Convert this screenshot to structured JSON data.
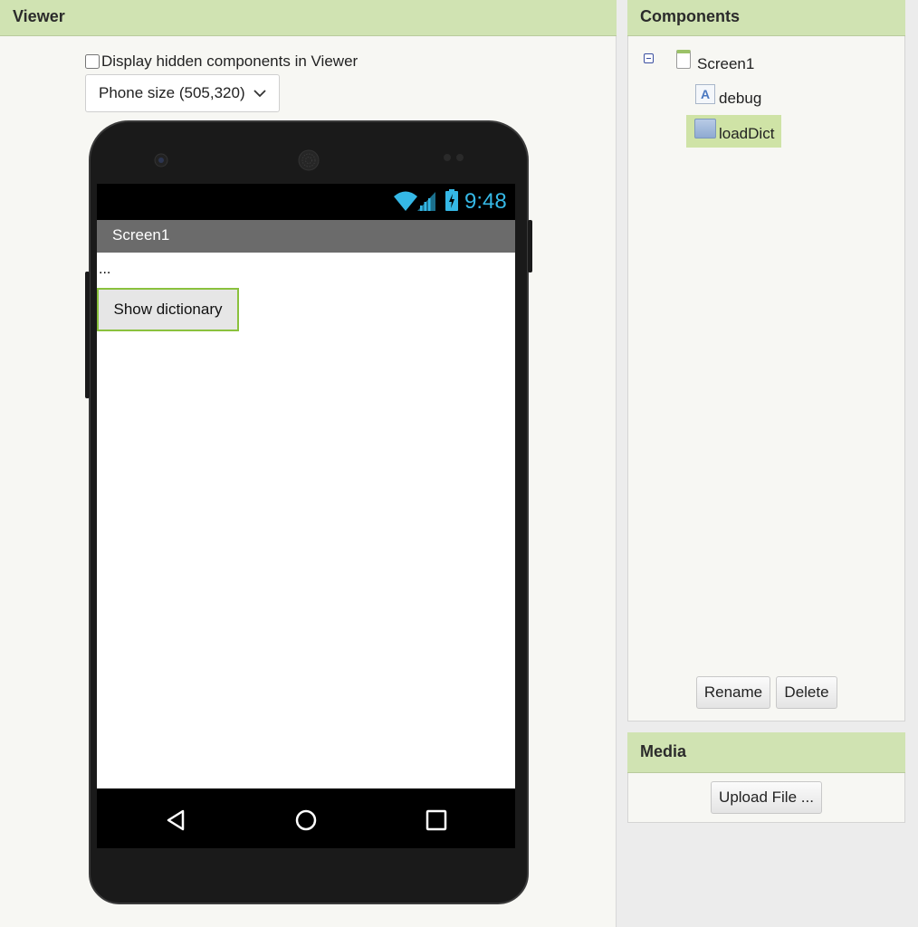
{
  "viewer": {
    "title": "Viewer",
    "hidden_components_label": "Display hidden components in Viewer",
    "hidden_components_checked": false,
    "size_select": "Phone size (505,320)"
  },
  "phone": {
    "status_time": "9:48",
    "screen_title": "Screen1",
    "debug_text": "...",
    "button_label": "Show dictionary"
  },
  "components": {
    "title": "Components",
    "tree": {
      "root": "Screen1",
      "children": [
        "debug",
        "loadDict"
      ],
      "selected": "loadDict"
    },
    "rename_label": "Rename",
    "delete_label": "Delete"
  },
  "media": {
    "title": "Media",
    "upload_label": "Upload File ..."
  },
  "colors": {
    "panel_header": "#d0e3b2",
    "selection": "#cfe3a6",
    "button_focus": "#8ac13d",
    "status_icons": "#35b8e6"
  }
}
